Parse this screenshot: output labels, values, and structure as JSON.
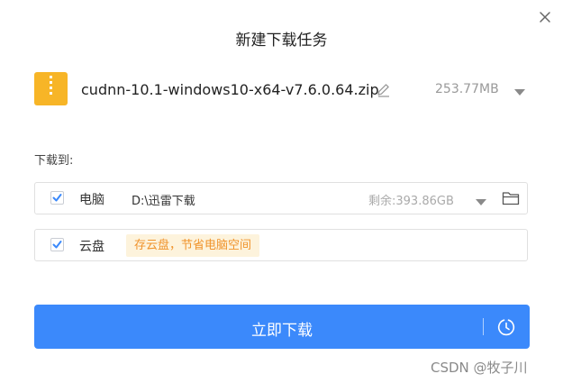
{
  "dialog": {
    "title": "新建下载任务",
    "file": {
      "name": "cudnn-10.1-windows10-x64-v7.6.0.64.zip",
      "size": "253.77MB"
    },
    "save_label": "下载到:",
    "pc": {
      "checked": true,
      "label": "电脑",
      "path": "D:\\迅雷下载",
      "free": "剩余:393.86GB"
    },
    "cloud": {
      "checked": true,
      "label": "云盘",
      "tip": "存云盘，节省电脑空间"
    },
    "download_button": "立即下载"
  },
  "watermark": "CSDN @牧子川",
  "colors": {
    "accent": "#3b89fb",
    "zip_icon": "#f7b527",
    "tip_text": "#f0932b",
    "tip_bg": "#fdf3dc"
  },
  "icons": [
    "close-icon",
    "zip-file-icon",
    "edit-icon",
    "chevron-down-icon",
    "checkmark-icon",
    "folder-icon",
    "clock-icon"
  ]
}
